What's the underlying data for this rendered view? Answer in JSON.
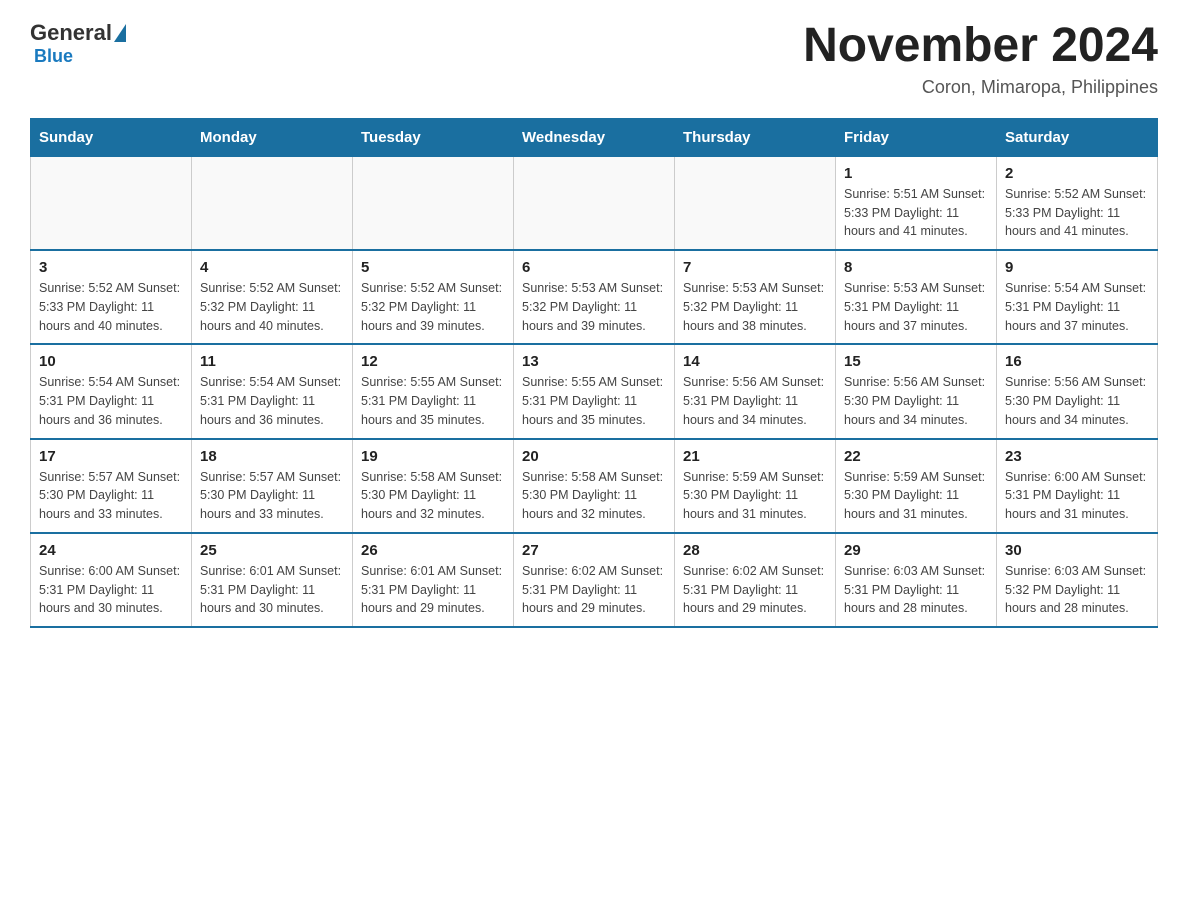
{
  "logo": {
    "general": "General",
    "blue": "Blue"
  },
  "header": {
    "month_year": "November 2024",
    "location": "Coron, Mimaropa, Philippines"
  },
  "weekdays": [
    "Sunday",
    "Monday",
    "Tuesday",
    "Wednesday",
    "Thursday",
    "Friday",
    "Saturday"
  ],
  "weeks": [
    [
      {
        "day": "",
        "info": ""
      },
      {
        "day": "",
        "info": ""
      },
      {
        "day": "",
        "info": ""
      },
      {
        "day": "",
        "info": ""
      },
      {
        "day": "",
        "info": ""
      },
      {
        "day": "1",
        "info": "Sunrise: 5:51 AM\nSunset: 5:33 PM\nDaylight: 11 hours and 41 minutes."
      },
      {
        "day": "2",
        "info": "Sunrise: 5:52 AM\nSunset: 5:33 PM\nDaylight: 11 hours and 41 minutes."
      }
    ],
    [
      {
        "day": "3",
        "info": "Sunrise: 5:52 AM\nSunset: 5:33 PM\nDaylight: 11 hours and 40 minutes."
      },
      {
        "day": "4",
        "info": "Sunrise: 5:52 AM\nSunset: 5:32 PM\nDaylight: 11 hours and 40 minutes."
      },
      {
        "day": "5",
        "info": "Sunrise: 5:52 AM\nSunset: 5:32 PM\nDaylight: 11 hours and 39 minutes."
      },
      {
        "day": "6",
        "info": "Sunrise: 5:53 AM\nSunset: 5:32 PM\nDaylight: 11 hours and 39 minutes."
      },
      {
        "day": "7",
        "info": "Sunrise: 5:53 AM\nSunset: 5:32 PM\nDaylight: 11 hours and 38 minutes."
      },
      {
        "day": "8",
        "info": "Sunrise: 5:53 AM\nSunset: 5:31 PM\nDaylight: 11 hours and 37 minutes."
      },
      {
        "day": "9",
        "info": "Sunrise: 5:54 AM\nSunset: 5:31 PM\nDaylight: 11 hours and 37 minutes."
      }
    ],
    [
      {
        "day": "10",
        "info": "Sunrise: 5:54 AM\nSunset: 5:31 PM\nDaylight: 11 hours and 36 minutes."
      },
      {
        "day": "11",
        "info": "Sunrise: 5:54 AM\nSunset: 5:31 PM\nDaylight: 11 hours and 36 minutes."
      },
      {
        "day": "12",
        "info": "Sunrise: 5:55 AM\nSunset: 5:31 PM\nDaylight: 11 hours and 35 minutes."
      },
      {
        "day": "13",
        "info": "Sunrise: 5:55 AM\nSunset: 5:31 PM\nDaylight: 11 hours and 35 minutes."
      },
      {
        "day": "14",
        "info": "Sunrise: 5:56 AM\nSunset: 5:31 PM\nDaylight: 11 hours and 34 minutes."
      },
      {
        "day": "15",
        "info": "Sunrise: 5:56 AM\nSunset: 5:30 PM\nDaylight: 11 hours and 34 minutes."
      },
      {
        "day": "16",
        "info": "Sunrise: 5:56 AM\nSunset: 5:30 PM\nDaylight: 11 hours and 34 minutes."
      }
    ],
    [
      {
        "day": "17",
        "info": "Sunrise: 5:57 AM\nSunset: 5:30 PM\nDaylight: 11 hours and 33 minutes."
      },
      {
        "day": "18",
        "info": "Sunrise: 5:57 AM\nSunset: 5:30 PM\nDaylight: 11 hours and 33 minutes."
      },
      {
        "day": "19",
        "info": "Sunrise: 5:58 AM\nSunset: 5:30 PM\nDaylight: 11 hours and 32 minutes."
      },
      {
        "day": "20",
        "info": "Sunrise: 5:58 AM\nSunset: 5:30 PM\nDaylight: 11 hours and 32 minutes."
      },
      {
        "day": "21",
        "info": "Sunrise: 5:59 AM\nSunset: 5:30 PM\nDaylight: 11 hours and 31 minutes."
      },
      {
        "day": "22",
        "info": "Sunrise: 5:59 AM\nSunset: 5:30 PM\nDaylight: 11 hours and 31 minutes."
      },
      {
        "day": "23",
        "info": "Sunrise: 6:00 AM\nSunset: 5:31 PM\nDaylight: 11 hours and 31 minutes."
      }
    ],
    [
      {
        "day": "24",
        "info": "Sunrise: 6:00 AM\nSunset: 5:31 PM\nDaylight: 11 hours and 30 minutes."
      },
      {
        "day": "25",
        "info": "Sunrise: 6:01 AM\nSunset: 5:31 PM\nDaylight: 11 hours and 30 minutes."
      },
      {
        "day": "26",
        "info": "Sunrise: 6:01 AM\nSunset: 5:31 PM\nDaylight: 11 hours and 29 minutes."
      },
      {
        "day": "27",
        "info": "Sunrise: 6:02 AM\nSunset: 5:31 PM\nDaylight: 11 hours and 29 minutes."
      },
      {
        "day": "28",
        "info": "Sunrise: 6:02 AM\nSunset: 5:31 PM\nDaylight: 11 hours and 29 minutes."
      },
      {
        "day": "29",
        "info": "Sunrise: 6:03 AM\nSunset: 5:31 PM\nDaylight: 11 hours and 28 minutes."
      },
      {
        "day": "30",
        "info": "Sunrise: 6:03 AM\nSunset: 5:32 PM\nDaylight: 11 hours and 28 minutes."
      }
    ]
  ]
}
